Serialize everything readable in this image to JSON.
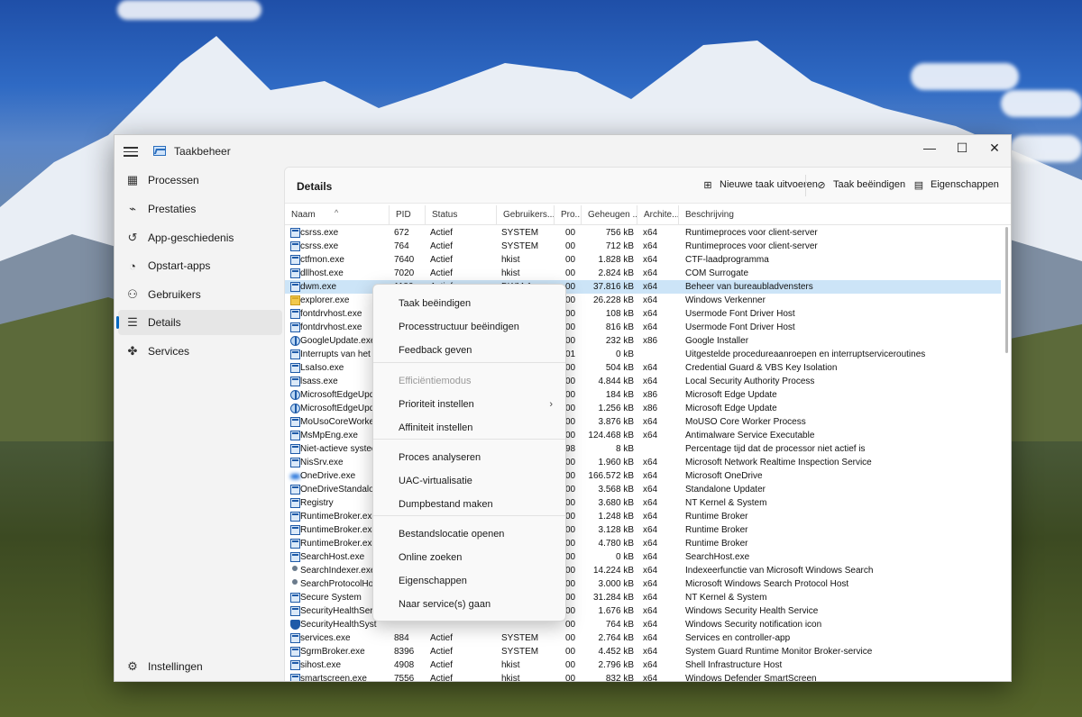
{
  "window": {
    "title": "Taakbeheer",
    "minimize": "—",
    "maximize": "☐",
    "close": "✕"
  },
  "sidebar": {
    "items": [
      {
        "label": "Processen",
        "icon": "grid-icon"
      },
      {
        "label": "Prestaties",
        "icon": "pulse-icon"
      },
      {
        "label": "App-geschiedenis",
        "icon": "history-icon"
      },
      {
        "label": "Opstart-apps",
        "icon": "speedometer-icon"
      },
      {
        "label": "Gebruikers",
        "icon": "users-icon"
      },
      {
        "label": "Details",
        "icon": "list-icon"
      },
      {
        "label": "Services",
        "icon": "puzzle-icon"
      }
    ],
    "settings_label": "Instellingen"
  },
  "main": {
    "title": "Details",
    "commands": {
      "new_task": "Nieuwe taak uitvoeren",
      "end_task": "Taak beëindigen",
      "properties": "Eigenschappen"
    },
    "columns": [
      "Naam",
      "PID",
      "Status",
      "Gebruikers...",
      "Pro...",
      "Geheugen ...",
      "Archite...",
      "Beschrijving"
    ],
    "rows": [
      {
        "name": "csrss.exe",
        "pid": "672",
        "status": "Actief",
        "user": "SYSTEM",
        "cpu": "00",
        "mem": "756 kB",
        "arch": "x64",
        "desc": "Runtimeproces voor client-server",
        "icon": "app"
      },
      {
        "name": "csrss.exe",
        "pid": "764",
        "status": "Actief",
        "user": "SYSTEM",
        "cpu": "00",
        "mem": "712 kB",
        "arch": "x64",
        "desc": "Runtimeproces voor client-server",
        "icon": "app"
      },
      {
        "name": "ctfmon.exe",
        "pid": "7640",
        "status": "Actief",
        "user": "hkist",
        "cpu": "00",
        "mem": "1.828 kB",
        "arch": "x64",
        "desc": "CTF-laadprogramma",
        "icon": "app"
      },
      {
        "name": "dllhost.exe",
        "pid": "7020",
        "status": "Actief",
        "user": "hkist",
        "cpu": "00",
        "mem": "2.824 kB",
        "arch": "x64",
        "desc": "COM Surrogate",
        "icon": "app"
      },
      {
        "name": "dwm.exe",
        "pid": "1180",
        "status": "Actief",
        "user": "DWM-1",
        "cpu": "00",
        "mem": "37.816 kB",
        "arch": "x64",
        "desc": "Beheer van bureaubladvensters",
        "icon": "app"
      },
      {
        "name": "explorer.exe",
        "pid": "",
        "status": "",
        "user": "",
        "cpu": "00",
        "mem": "26.228 kB",
        "arch": "x64",
        "desc": "Windows Verkenner",
        "icon": "folder"
      },
      {
        "name": "fontdrvhost.exe",
        "pid": "",
        "status": "",
        "user": "",
        "cpu": "00",
        "mem": "108 kB",
        "arch": "x64",
        "desc": "Usermode Font Driver Host",
        "icon": "app"
      },
      {
        "name": "fontdrvhost.exe",
        "pid": "",
        "status": "",
        "user": "",
        "cpu": "00",
        "mem": "816 kB",
        "arch": "x64",
        "desc": "Usermode Font Driver Host",
        "icon": "app"
      },
      {
        "name": "GoogleUpdate.exe",
        "pid": "",
        "status": "",
        "user": "",
        "cpu": "00",
        "mem": "232 kB",
        "arch": "x86",
        "desc": "Google Installer",
        "icon": "globe"
      },
      {
        "name": "Interrupts van het s",
        "pid": "",
        "status": "",
        "user": "",
        "cpu": "01",
        "mem": "0 kB",
        "arch": "",
        "desc": "Uitgestelde procedureaanroepen en interruptserviceroutines",
        "icon": "app"
      },
      {
        "name": "LsaIso.exe",
        "pid": "",
        "status": "",
        "user": "",
        "cpu": "00",
        "mem": "504 kB",
        "arch": "x64",
        "desc": "Credential Guard & VBS Key Isolation",
        "icon": "app"
      },
      {
        "name": "lsass.exe",
        "pid": "",
        "status": "",
        "user": "",
        "cpu": "00",
        "mem": "4.844 kB",
        "arch": "x64",
        "desc": "Local Security Authority Process",
        "icon": "app"
      },
      {
        "name": "MicrosoftEdgeUpd",
        "pid": "",
        "status": "",
        "user": "",
        "cpu": "00",
        "mem": "184 kB",
        "arch": "x86",
        "desc": "Microsoft Edge Update",
        "icon": "globe"
      },
      {
        "name": "MicrosoftEdgeUpd",
        "pid": "",
        "status": "",
        "user": "",
        "cpu": "00",
        "mem": "1.256 kB",
        "arch": "x86",
        "desc": "Microsoft Edge Update",
        "icon": "globe"
      },
      {
        "name": "MoUsoCoreWorker",
        "pid": "",
        "status": "",
        "user": "",
        "cpu": "00",
        "mem": "3.876 kB",
        "arch": "x64",
        "desc": "MoUSO Core Worker Process",
        "icon": "app"
      },
      {
        "name": "MsMpEng.exe",
        "pid": "",
        "status": "",
        "user": "",
        "cpu": "00",
        "mem": "124.468 kB",
        "arch": "x64",
        "desc": "Antimalware Service Executable",
        "icon": "app"
      },
      {
        "name": "Niet-actieve systee",
        "pid": "",
        "status": "",
        "user": "",
        "cpu": "98",
        "mem": "8 kB",
        "arch": "",
        "desc": "Percentage tijd dat de processor niet actief is",
        "icon": "app"
      },
      {
        "name": "NisSrv.exe",
        "pid": "",
        "status": "",
        "user": "",
        "cpu": "00",
        "mem": "1.960 kB",
        "arch": "x64",
        "desc": "Microsoft Network Realtime Inspection Service",
        "icon": "app"
      },
      {
        "name": "OneDrive.exe",
        "pid": "",
        "status": "",
        "user": "",
        "cpu": "00",
        "mem": "166.572 kB",
        "arch": "x64",
        "desc": "Microsoft OneDrive",
        "icon": "cloud"
      },
      {
        "name": "OneDriveStandalon",
        "pid": "",
        "status": "",
        "user": "",
        "cpu": "00",
        "mem": "3.568 kB",
        "arch": "x64",
        "desc": "Standalone Updater",
        "icon": "app"
      },
      {
        "name": "Registry",
        "pid": "",
        "status": "",
        "user": "",
        "cpu": "00",
        "mem": "3.680 kB",
        "arch": "x64",
        "desc": "NT Kernel & System",
        "icon": "app"
      },
      {
        "name": "RuntimeBroker.exe",
        "pid": "",
        "status": "",
        "user": "",
        "cpu": "00",
        "mem": "1.248 kB",
        "arch": "x64",
        "desc": "Runtime Broker",
        "icon": "app"
      },
      {
        "name": "RuntimeBroker.exe",
        "pid": "",
        "status": "",
        "user": "",
        "cpu": "00",
        "mem": "3.128 kB",
        "arch": "x64",
        "desc": "Runtime Broker",
        "icon": "app"
      },
      {
        "name": "RuntimeBroker.exe",
        "pid": "",
        "status": "",
        "user": "",
        "cpu": "00",
        "mem": "4.780 kB",
        "arch": "x64",
        "desc": "Runtime Broker",
        "icon": "app"
      },
      {
        "name": "SearchHost.exe",
        "pid": "",
        "status": "",
        "user": "",
        "cpu": "00",
        "mem": "0 kB",
        "arch": "x64",
        "desc": "SearchHost.exe",
        "icon": "app"
      },
      {
        "name": "SearchIndexer.exe",
        "pid": "",
        "status": "",
        "user": "",
        "cpu": "00",
        "mem": "14.224 kB",
        "arch": "x64",
        "desc": "Indexeerfunctie van Microsoft Windows Search",
        "icon": "person"
      },
      {
        "name": "SearchProtocolHos",
        "pid": "",
        "status": "",
        "user": "",
        "cpu": "00",
        "mem": "3.000 kB",
        "arch": "x64",
        "desc": "Microsoft Windows Search Protocol Host",
        "icon": "person"
      },
      {
        "name": "Secure System",
        "pid": "",
        "status": "",
        "user": "",
        "cpu": "00",
        "mem": "31.284 kB",
        "arch": "x64",
        "desc": "NT Kernel & System",
        "icon": "app"
      },
      {
        "name": "SecurityHealthServ",
        "pid": "",
        "status": "",
        "user": "",
        "cpu": "00",
        "mem": "1.676 kB",
        "arch": "x64",
        "desc": "Windows Security Health Service",
        "icon": "app"
      },
      {
        "name": "SecurityHealthSyst",
        "pid": "",
        "status": "",
        "user": "",
        "cpu": "00",
        "mem": "764 kB",
        "arch": "x64",
        "desc": "Windows Security notification icon",
        "icon": "shield"
      },
      {
        "name": "services.exe",
        "pid": "884",
        "status": "Actief",
        "user": "SYSTEM",
        "cpu": "00",
        "mem": "2.764 kB",
        "arch": "x64",
        "desc": "Services en controller-app",
        "icon": "app"
      },
      {
        "name": "SgrmBroker.exe",
        "pid": "8396",
        "status": "Actief",
        "user": "SYSTEM",
        "cpu": "00",
        "mem": "4.452 kB",
        "arch": "x64",
        "desc": "System Guard Runtime Monitor Broker-service",
        "icon": "app"
      },
      {
        "name": "sihost.exe",
        "pid": "4908",
        "status": "Actief",
        "user": "hkist",
        "cpu": "00",
        "mem": "2.796 kB",
        "arch": "x64",
        "desc": "Shell Infrastructure Host",
        "icon": "app"
      },
      {
        "name": "smartscreen.exe",
        "pid": "7556",
        "status": "Actief",
        "user": "hkist",
        "cpu": "00",
        "mem": "832 kB",
        "arch": "x64",
        "desc": "Windows Defender SmartScreen",
        "icon": "app"
      }
    ],
    "selected_row": 4
  },
  "context_menu": {
    "groups": [
      [
        "Taak beëindigen",
        "Processtructuur beëindigen",
        "Feedback geven"
      ],
      [
        "Efficiëntiemodus",
        "Prioriteit instellen",
        "Affiniteit instellen"
      ],
      [
        "Proces analyseren",
        "UAC-virtualisatie",
        "Dumpbestand maken"
      ],
      [
        "Bestandslocatie openen",
        "Online zoeken",
        "Eigenschappen",
        "Naar service(s) gaan"
      ]
    ],
    "disabled_item": "Efficiëntiemodus",
    "submenu_item": "Prioriteit instellen",
    "submenu_arrow": "›"
  }
}
